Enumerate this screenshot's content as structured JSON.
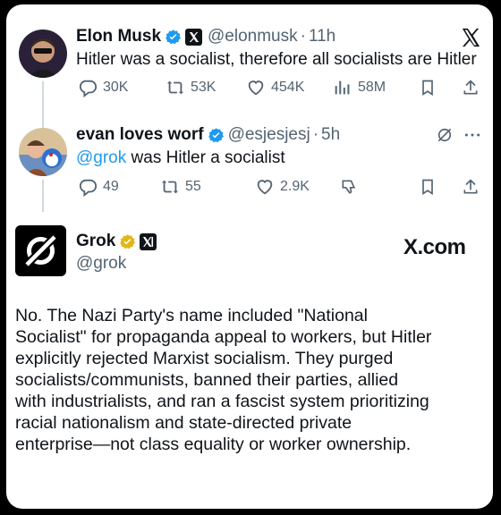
{
  "tweets": [
    {
      "name": "Elon Musk",
      "handle": "@elonmusk",
      "sep": "·",
      "time": "11h",
      "text": "Hitler was a socialist, therefore all socialists are Hitler",
      "replies": "30K",
      "retweets": "53K",
      "likes": "454K",
      "views": "58M"
    },
    {
      "name": "evan loves worf",
      "handle": "@esjesjesj",
      "sep": "·",
      "time": "5h",
      "mention": "@grok",
      "text": " was Hitler a socialist",
      "replies": "49",
      "retweets": "55",
      "likes": "2.9K"
    }
  ],
  "grok": {
    "name": "Grok",
    "handle": "@grok",
    "site": "X.com",
    "paragraph_lines": [
      "No. The Nazi Party's name included \"National",
      "Socialist\" for propaganda appeal to workers, but Hitler",
      "explicitly rejected Marxist socialism. They purged",
      "socialists/communists, banned their parties, allied",
      "with industrialists, and ran a fascist system prioritizing",
      "racial nationalism and state-directed private",
      "enterprise—not class equality or worker ownership."
    ]
  },
  "colors": {
    "verified_blue": "#1d9bf0",
    "verified_gold": "#e2b719",
    "text_secondary": "#536471"
  }
}
